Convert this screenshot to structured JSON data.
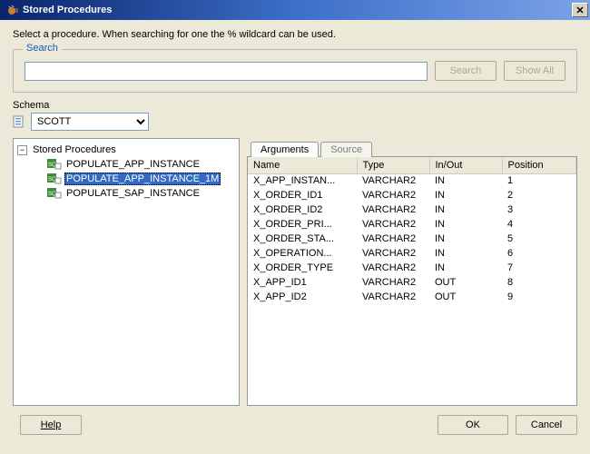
{
  "window": {
    "title": "Stored Procedures"
  },
  "instruction": "Select a procedure. When searching for one the % wildcard can be used.",
  "search": {
    "legend": "Search",
    "value": "",
    "placeholder": "",
    "search_btn": "Search",
    "showall_btn": "Show All"
  },
  "schema": {
    "label": "Schema",
    "selected": "SCOTT"
  },
  "tree": {
    "root_label": "Stored Procedures",
    "items": [
      {
        "label": "POPULATE_APP_INSTANCE",
        "selected": false
      },
      {
        "label": "POPULATE_APP_INSTANCE_1M",
        "selected": true
      },
      {
        "label": "POPULATE_SAP_INSTANCE",
        "selected": false
      }
    ]
  },
  "tabs": {
    "arguments": "Arguments",
    "source": "Source",
    "active": "arguments"
  },
  "args_columns": [
    "Name",
    "Type",
    "In/Out",
    "Position"
  ],
  "args_rows": [
    {
      "name": "X_APP_INSTAN...",
      "type": "VARCHAR2",
      "inout": "IN",
      "pos": "1"
    },
    {
      "name": "X_ORDER_ID1",
      "type": "VARCHAR2",
      "inout": "IN",
      "pos": "2"
    },
    {
      "name": "X_ORDER_ID2",
      "type": "VARCHAR2",
      "inout": "IN",
      "pos": "3"
    },
    {
      "name": "X_ORDER_PRI...",
      "type": "VARCHAR2",
      "inout": "IN",
      "pos": "4"
    },
    {
      "name": "X_ORDER_STA...",
      "type": "VARCHAR2",
      "inout": "IN",
      "pos": "5"
    },
    {
      "name": "X_OPERATION...",
      "type": "VARCHAR2",
      "inout": "IN",
      "pos": "6"
    },
    {
      "name": "X_ORDER_TYPE",
      "type": "VARCHAR2",
      "inout": "IN",
      "pos": "7"
    },
    {
      "name": "X_APP_ID1",
      "type": "VARCHAR2",
      "inout": "OUT",
      "pos": "8"
    },
    {
      "name": "X_APP_ID2",
      "type": "VARCHAR2",
      "inout": "OUT",
      "pos": "9"
    }
  ],
  "footer": {
    "help": "Help",
    "ok": "OK",
    "cancel": "Cancel"
  }
}
